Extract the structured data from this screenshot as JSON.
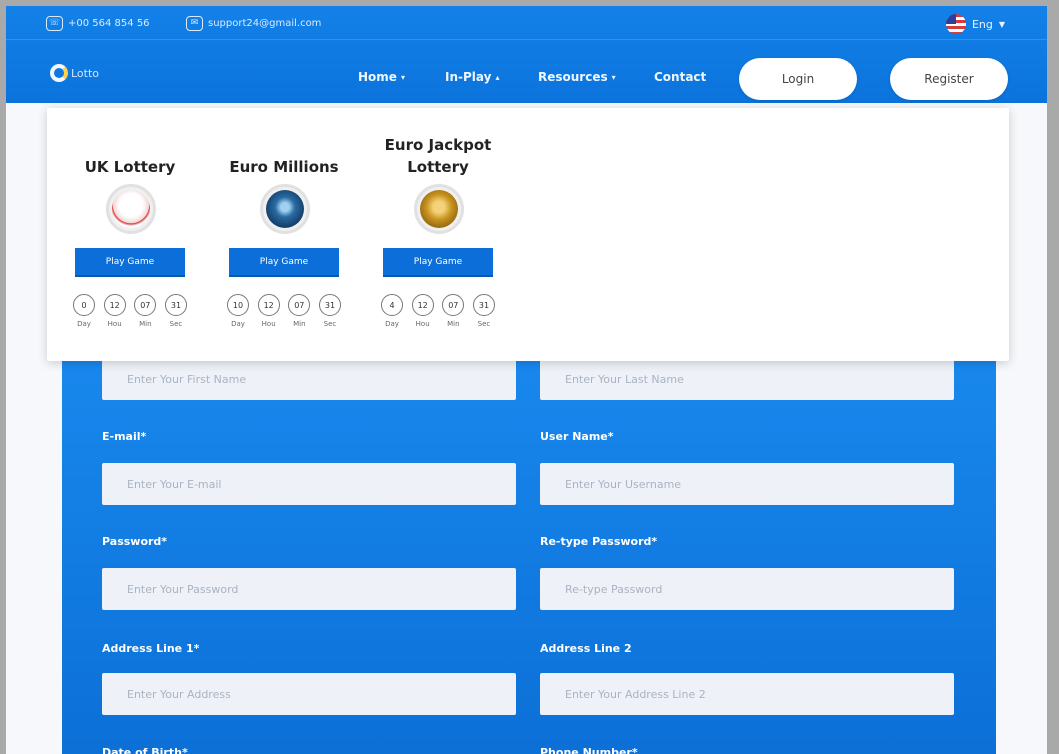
{
  "topbar": {
    "phone": "+00 564 854 56",
    "email": "support24@gmail.com",
    "language": "Eng"
  },
  "navbar": {
    "logo_text": "Lotto",
    "links": [
      {
        "label": "Home",
        "caret": "▾"
      },
      {
        "label": "In-Play",
        "caret": "▴"
      },
      {
        "label": "Resources",
        "caret": "▾"
      },
      {
        "label": "Contact",
        "caret": ""
      }
    ],
    "login_label": "Login",
    "register_label": "Register"
  },
  "dropdown": {
    "play_label": "Play Game",
    "unit_labels": [
      "Day",
      "Hou",
      "Min",
      "Sec"
    ],
    "cards": [
      {
        "title": "UK Lottery",
        "ball_color": "#ffffff",
        "countdown": [
          "0",
          "12",
          "07",
          "31"
        ]
      },
      {
        "title": "Euro Millions",
        "ball_color": "#1f5e96",
        "countdown": [
          "10",
          "12",
          "07",
          "31"
        ]
      },
      {
        "title": "Euro Jackpot Lottery",
        "ball_color": "#c8931e",
        "countdown": [
          "4",
          "12",
          "07",
          "31"
        ]
      }
    ]
  },
  "form": {
    "first_name_placeholder": "Enter Your First Name",
    "last_name_placeholder": "Enter Your Last Name",
    "email_label": "E-mail*",
    "email_placeholder": "Enter Your E-mail",
    "username_label": "User Name*",
    "username_placeholder": "Enter Your Username",
    "password_label": "Password*",
    "password_placeholder": "Enter Your Password",
    "retype_label": "Re-type Password*",
    "retype_placeholder": "Re-type Password",
    "address1_label": "Address Line 1*",
    "address1_placeholder": "Enter Your Address",
    "address2_label": "Address Line 2",
    "address2_placeholder": "Enter Your Address Line 2",
    "dob_label": "Date of Birth*",
    "phone_label": "Phone Number*"
  },
  "colors": {
    "header_blue": "#0b74dc",
    "button_blue": "#0c6fd9",
    "form_blue": "#1a8bf0"
  }
}
